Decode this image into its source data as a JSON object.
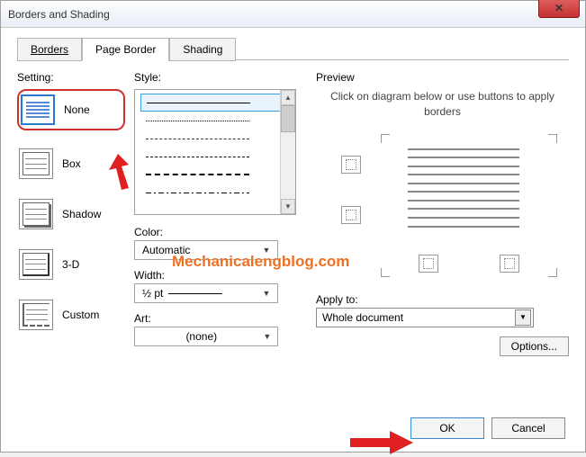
{
  "title": "Borders and Shading",
  "tabs": {
    "borders": "Borders",
    "page_border": "Page Border",
    "shading": "Shading"
  },
  "setting": {
    "label": "Setting:",
    "none": "None",
    "box": "Box",
    "shadow": "Shadow",
    "threed": "3-D",
    "custom": "Custom"
  },
  "style": {
    "label": "Style:",
    "color_label": "Color:",
    "color_value": "Automatic",
    "width_label": "Width:",
    "width_value": "½ pt",
    "art_label": "Art:",
    "art_value": "(none)"
  },
  "preview": {
    "label": "Preview",
    "hint": "Click on diagram below or use buttons to apply borders",
    "applyto_label": "Apply to:",
    "applyto_value": "Whole document",
    "options": "Options..."
  },
  "buttons": {
    "ok": "OK",
    "cancel": "Cancel"
  },
  "watermark": "Mechanicalengblog.com"
}
